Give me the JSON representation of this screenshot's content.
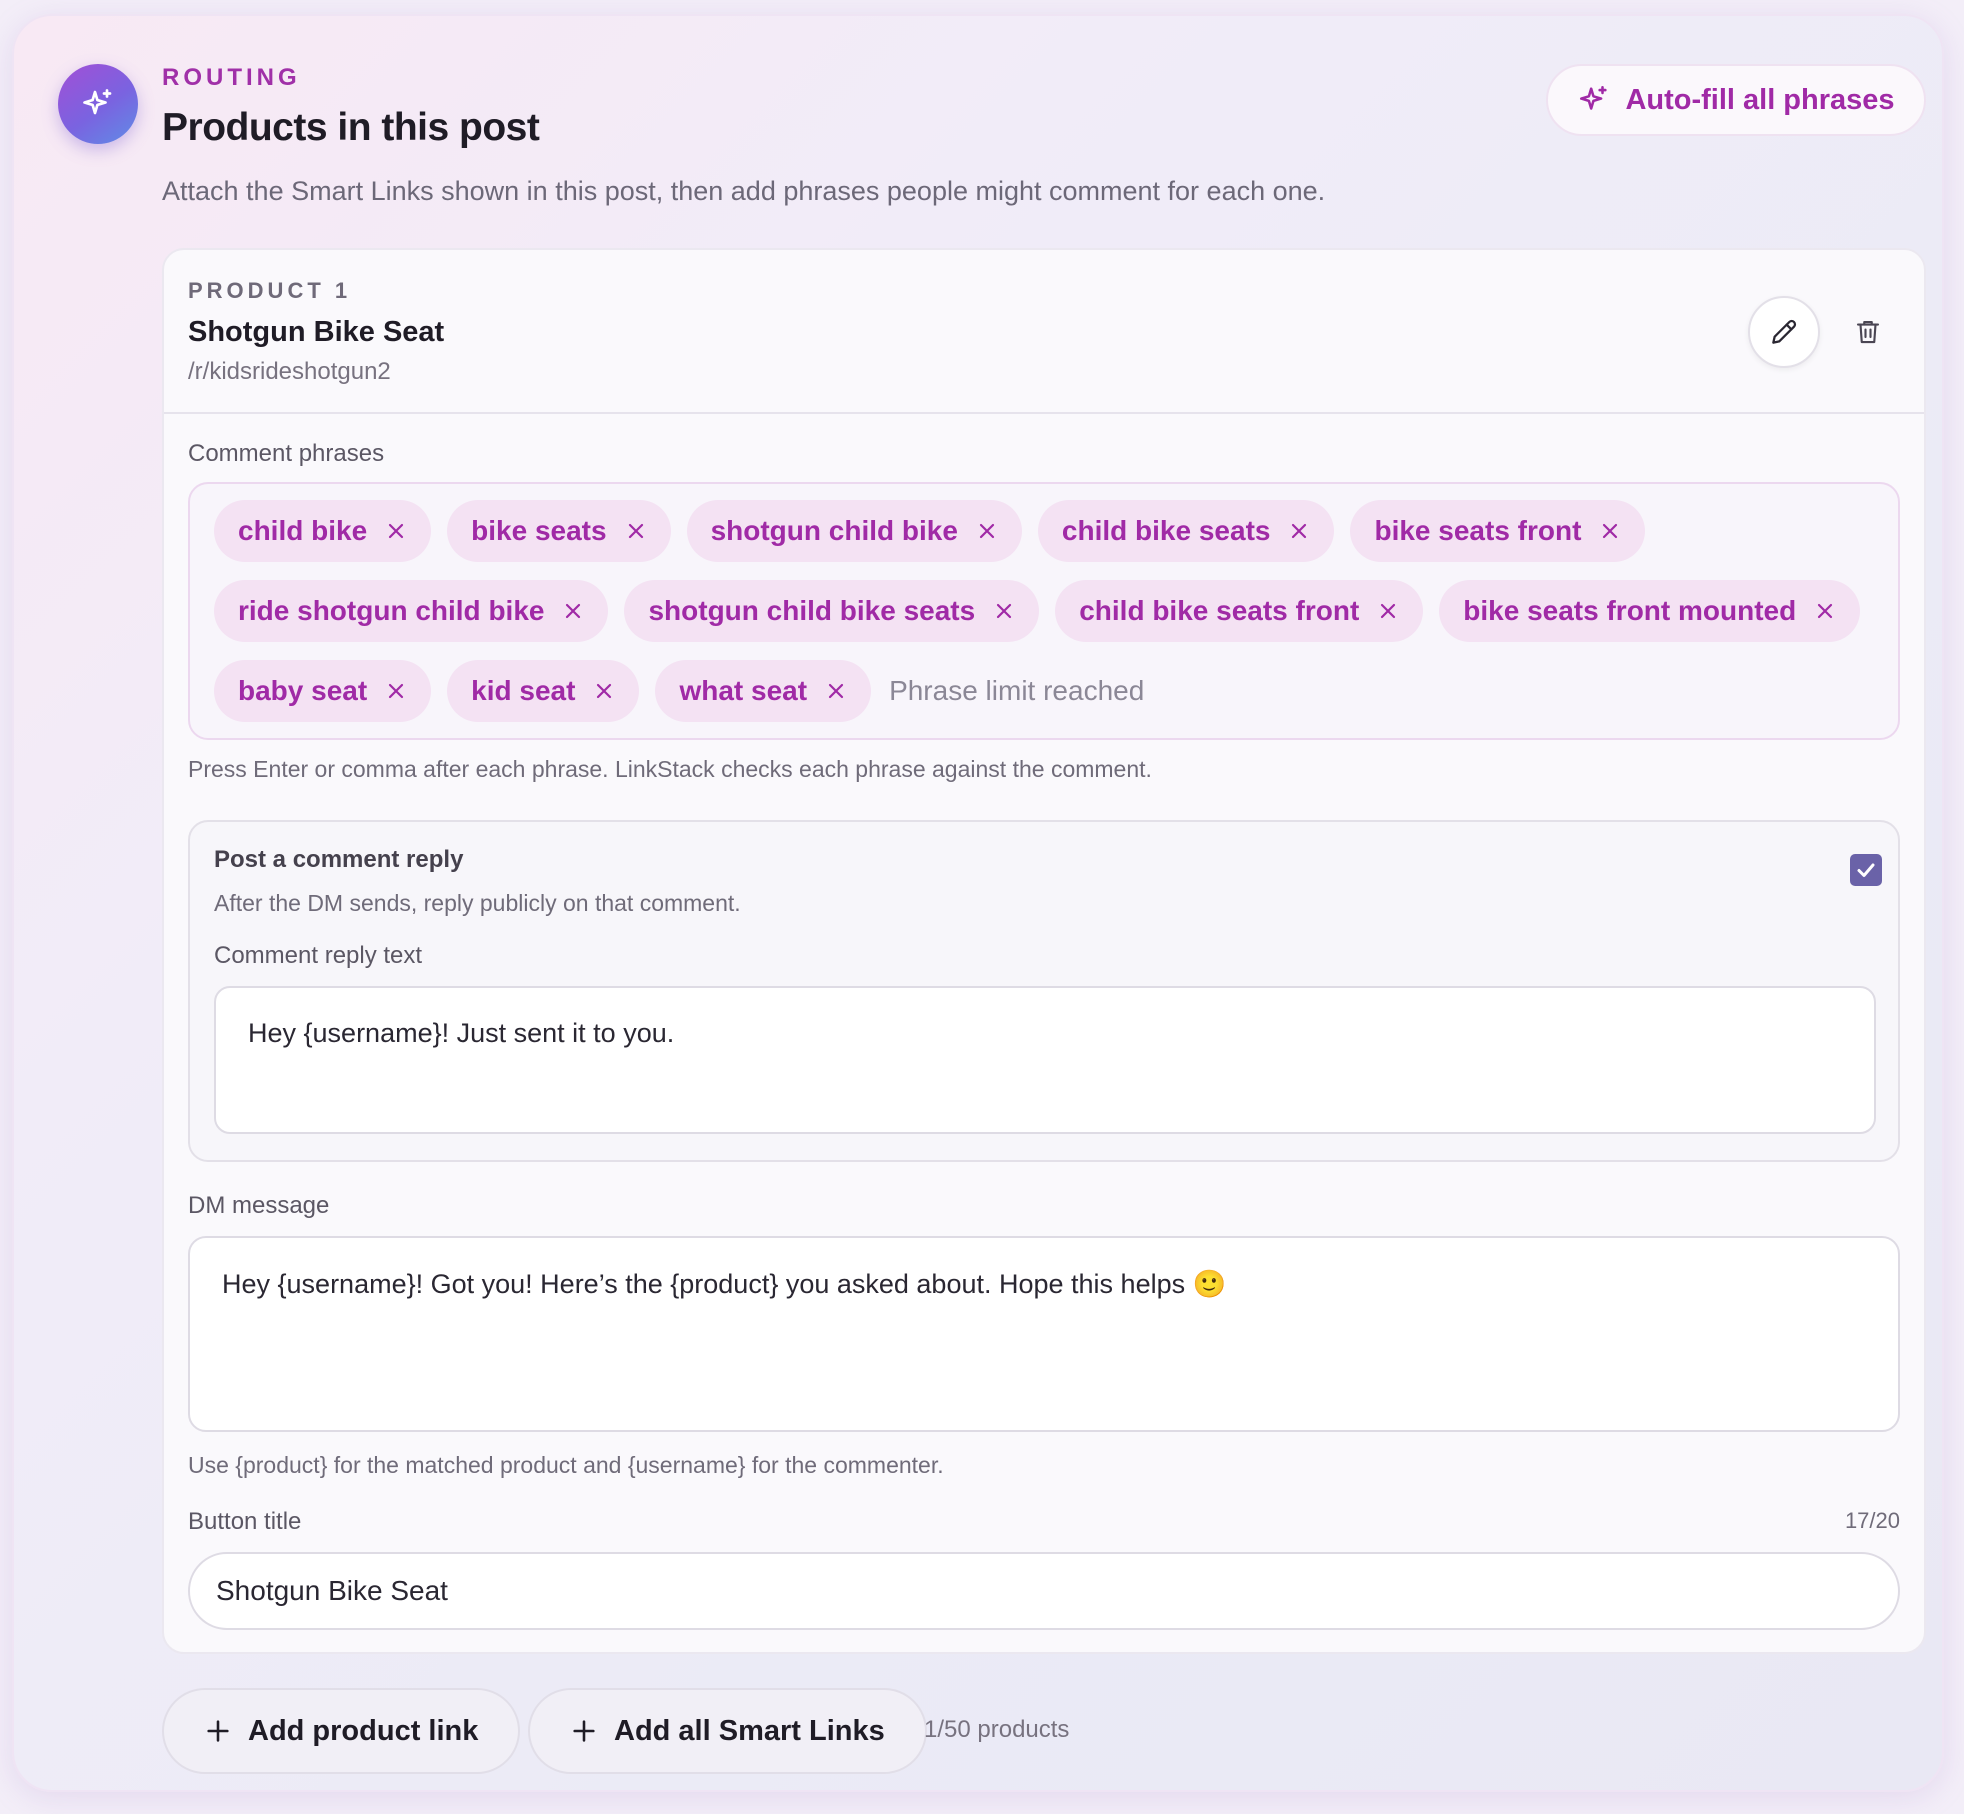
{
  "header": {
    "eyebrow": "ROUTING",
    "title": "Products in this post",
    "subtitle": "Attach the Smart Links shown in this post, then add phrases people might comment for each one.",
    "autofill_label": "Auto-fill all phrases"
  },
  "product": {
    "eyebrow": "PRODUCT 1",
    "name": "Shotgun Bike Seat",
    "path": "/r/kidsrideshotgun2"
  },
  "phrases": {
    "label": "Comment phrases",
    "rows": [
      [
        "child bike",
        "bike seats",
        "shotgun child bike",
        "child bike seats",
        "bike seats front"
      ],
      [
        "ride shotgun child bike",
        "shotgun child bike seats",
        "child bike seats front",
        "bike seats front mounted"
      ],
      [
        "baby seat",
        "kid seat",
        "what seat"
      ]
    ],
    "limit_text": "Phrase limit reached",
    "hint": "Press Enter or comma after each phrase. LinkStack checks each phrase against the comment."
  },
  "reply": {
    "title": "Post a comment reply",
    "description": "After the DM sends, reply publicly on that comment.",
    "checked": true,
    "text_label": "Comment reply text",
    "text_value": "Hey {username}! Just sent it to you."
  },
  "dm": {
    "label": "DM message",
    "value": "Hey {username}! Got you! Here’s the {product} you asked about. Hope this helps 🙂",
    "hint": "Use {product} for the matched product and {username} for the commenter."
  },
  "button_title": {
    "label": "Button title",
    "counter": "17/20",
    "value": "Shotgun Bike Seat"
  },
  "footer": {
    "add_product_label": "Add product link",
    "add_all_label": "Add all Smart Links",
    "count_note": "1/50 products"
  },
  "colors": {
    "accent": "#a02aa6",
    "chip_bg": "#f4e2f3",
    "checkbox": "#6a62a8"
  },
  "icons": {
    "badge": "sparkle-icon",
    "autofill": "sparkle-icon",
    "edit": "pencil-icon",
    "delete": "trash-icon",
    "chip_remove": "close-icon",
    "checkbox": "check-icon",
    "add": "plus-icon"
  }
}
